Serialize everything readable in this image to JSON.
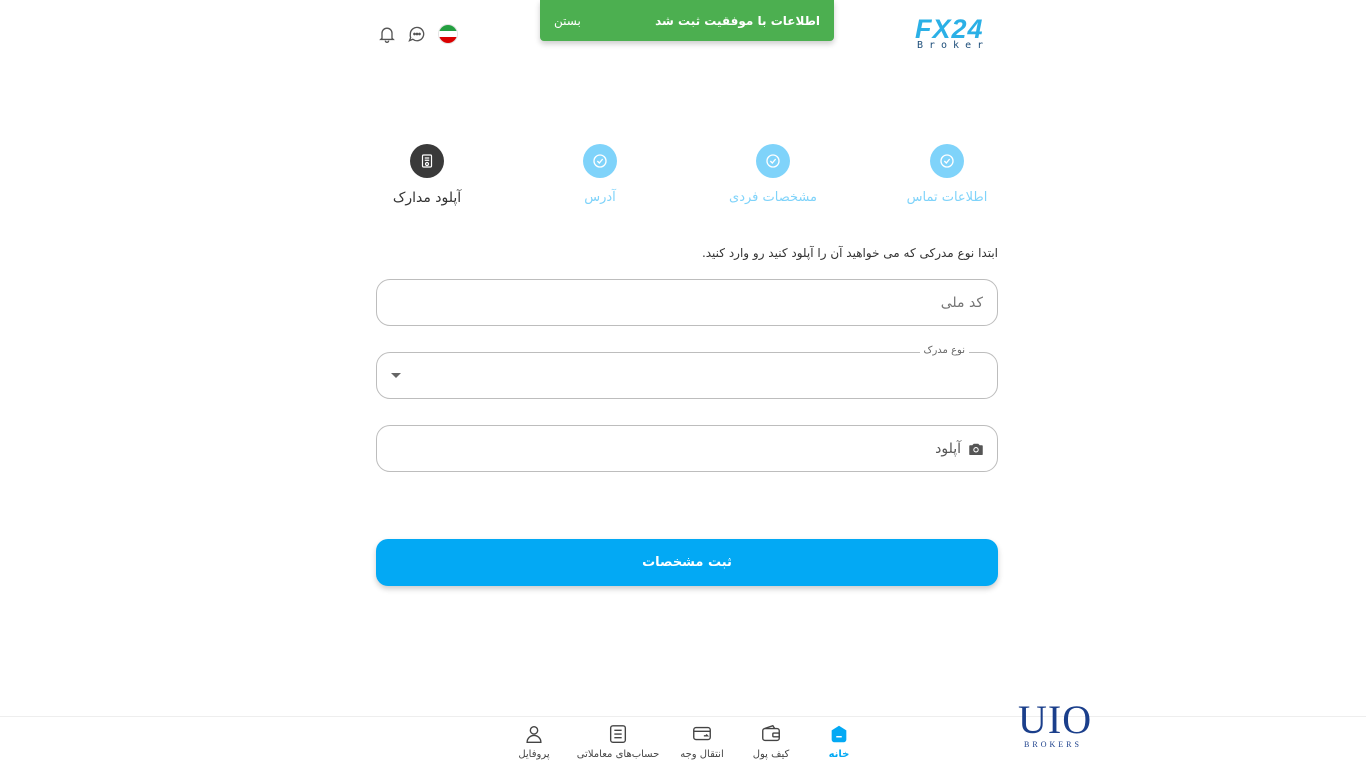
{
  "header": {
    "logo_top": "FX24",
    "logo_bottom": "Broker"
  },
  "toast": {
    "message": "اطلاعات با موفقیت ثبت شد",
    "close_label": "بستن"
  },
  "steps": [
    {
      "label": "اطلاعات تماس",
      "status": "done"
    },
    {
      "label": "مشخصات فردی",
      "status": "done"
    },
    {
      "label": "آدرس",
      "status": "done"
    },
    {
      "label": "آپلود مدارک",
      "status": "active"
    }
  ],
  "form": {
    "instruction": "ابتدا نوع مدرکی که می خواهید آن را آپلود کنید رو وارد کنید.",
    "national_code_placeholder": "کد ملی",
    "doc_type_legend": "نوع مدرک",
    "upload_label": "آپلود",
    "submit_label": "ثبت مشخصات"
  },
  "bottom_nav": [
    {
      "label": "خانه",
      "icon": "home-icon",
      "active": true
    },
    {
      "label": "کیف پول",
      "icon": "wallet-icon",
      "active": false
    },
    {
      "label": "انتقال وجه",
      "icon": "card-transfer-icon",
      "active": false
    },
    {
      "label": "حساب‌های معاملاتی",
      "icon": "accounts-list-icon",
      "active": false
    },
    {
      "label": "پروفایل",
      "icon": "user-icon",
      "active": false
    }
  ],
  "watermark": {
    "top": "UIO",
    "bottom": "BROKERS"
  },
  "colors": {
    "accent": "#03a9f4",
    "step_done": "#7fd3fa",
    "step_active": "#3a3a3a",
    "toast_bg": "#4caf50"
  }
}
